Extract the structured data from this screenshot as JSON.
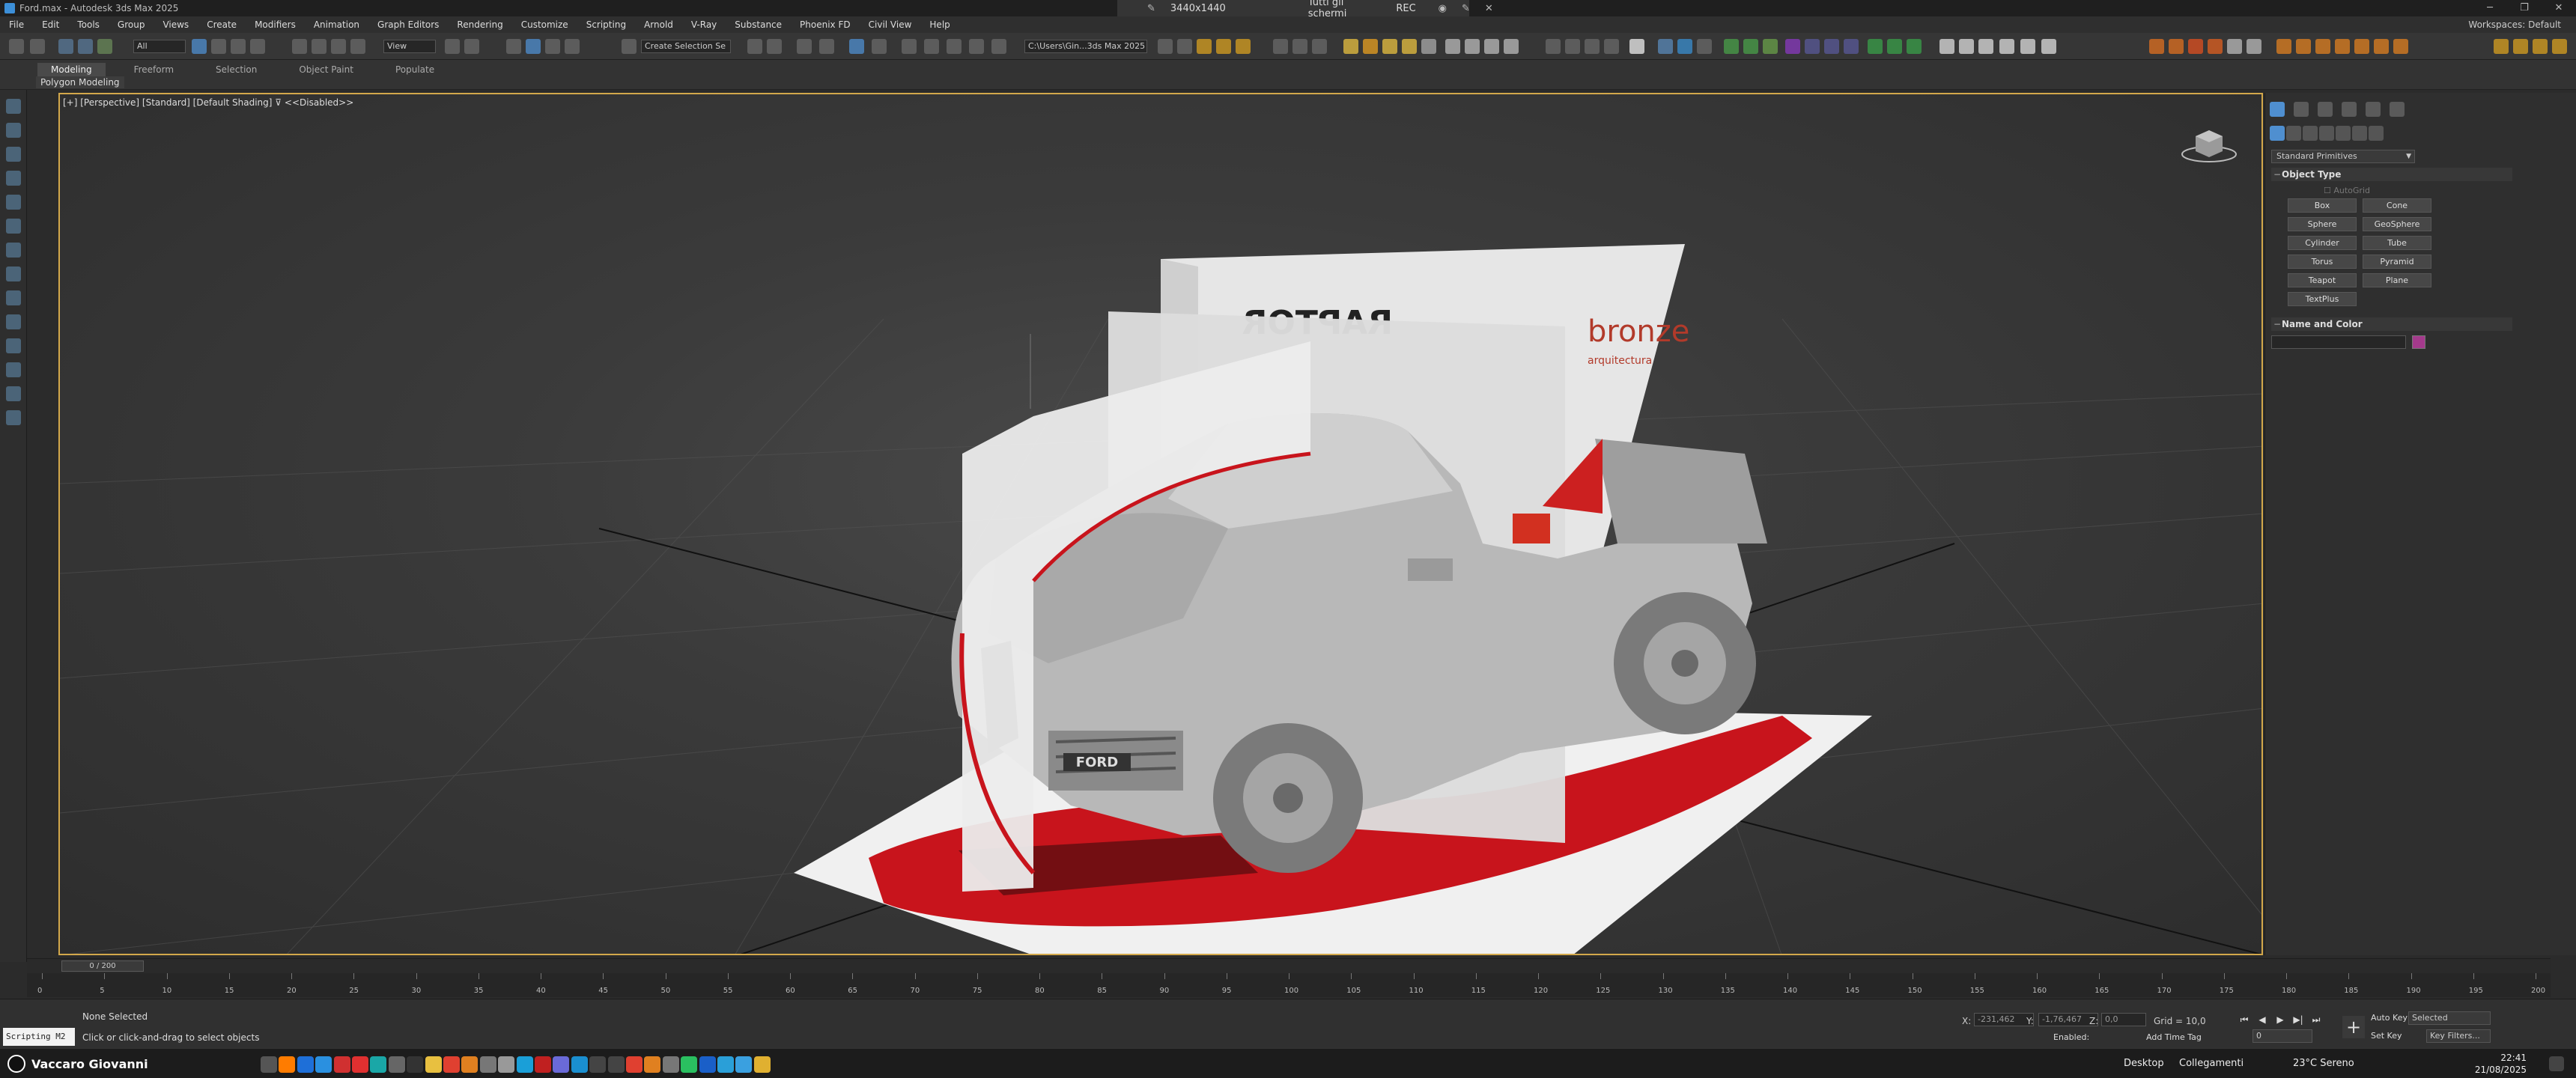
{
  "titlebar": {
    "title": "Ford.max - Autodesk 3ds Max 2025",
    "rec_resolution": "3440x1440",
    "rec_screens": "Tutti gli schermi",
    "rec_label": "REC"
  },
  "menu": {
    "items": [
      "File",
      "Edit",
      "Tools",
      "Group",
      "Views",
      "Create",
      "Modifiers",
      "Animation",
      "Graph Editors",
      "Rendering",
      "Customize",
      "Scripting",
      "Arnold",
      "V-Ray",
      "Substance",
      "Phoenix FD",
      "Civil View",
      "Help"
    ],
    "workspace_label": "Workspaces:",
    "workspace_value": "Default"
  },
  "toolbar": {
    "filter_value": "All",
    "view_value": "View",
    "selection_set_placeholder": "Create Selection Se",
    "project_path": "C:\\Users\\Gin...3ds Max 2025"
  },
  "ribbon": {
    "tabs": [
      "Modeling",
      "Freeform",
      "Selection",
      "Object Paint",
      "Populate"
    ],
    "sub_label": "Polygon Modeling"
  },
  "viewport": {
    "label": "[+] [Perspective] [Standard] [Default Shading]",
    "disabled_label": "<<Disabled>>"
  },
  "command_panel": {
    "category": "Standard Primitives",
    "object_type_title": "Object Type",
    "autogrid_label": "AutoGrid",
    "primitives": [
      "Box",
      "Cone",
      "Sphere",
      "GeoSphere",
      "Cylinder",
      "Tube",
      "Torus",
      "Pyramid",
      "Teapot",
      "Plane",
      "TextPlus"
    ],
    "name_color_title": "Name and Color",
    "color": "#a43a8c"
  },
  "timeline": {
    "frame_display": "0 / 200",
    "ticks": [
      "0",
      "5",
      "10",
      "15",
      "20",
      "25",
      "30",
      "35",
      "40",
      "45",
      "50",
      "55",
      "60",
      "65",
      "70",
      "75",
      "80",
      "85",
      "90",
      "95",
      "100",
      "105",
      "110",
      "115",
      "120",
      "125",
      "130",
      "135",
      "140",
      "145",
      "150",
      "155",
      "160",
      "165",
      "170",
      "175",
      "180",
      "185",
      "190",
      "195",
      "200"
    ]
  },
  "status": {
    "maxscript_label": "Scripting M2",
    "selection_status": "None Selected",
    "prompt": "Click or click-and-drag to select objects",
    "x_label": "X:",
    "x_value": "-231,462",
    "y_label": "Y:",
    "y_value": "-1,76,467",
    "z_label": "Z:",
    "z_value": "0,0",
    "grid": "Grid = 10,0",
    "enabled_label": "Enabled:",
    "add_time_tag": "Add Time Tag",
    "auto_key": "Auto Key",
    "set_key": "Set Key",
    "selected_value": "Selected",
    "key_filters": "Key Filters...",
    "frame_field": "0"
  },
  "taskbar": {
    "user": "Vaccaro Giovanni",
    "desktop": "Desktop",
    "links": "Collegamenti",
    "weather": "23°C  Sereno",
    "time": "22:41",
    "date": "21/08/2025"
  }
}
